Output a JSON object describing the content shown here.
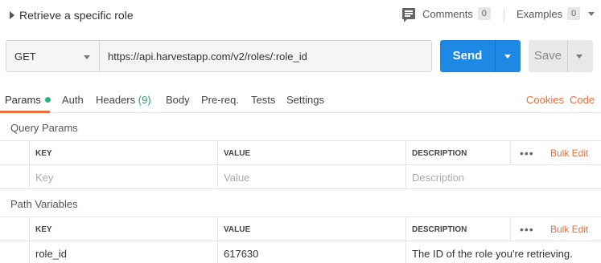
{
  "request": {
    "name": "Retrieve a specific role",
    "method": "GET",
    "url": "https://api.harvestapp.com/v2/roles/:role_id"
  },
  "header": {
    "comments_label": "Comments",
    "comments_count": "0",
    "examples_label": "Examples",
    "examples_count": "0"
  },
  "actions": {
    "send_label": "Send",
    "save_label": "Save"
  },
  "tabs": {
    "params": "Params",
    "auth": "Auth",
    "headers": "Headers",
    "headers_count": "(9)",
    "body": "Body",
    "prereq": "Pre-req.",
    "tests": "Tests",
    "settings": "Settings",
    "cookies": "Cookies",
    "code": "Code"
  },
  "query_params": {
    "title": "Query Params",
    "columns": [
      "KEY",
      "VALUE",
      "DESCRIPTION"
    ],
    "bulk_edit": "Bulk Edit",
    "more": "•••",
    "placeholder": {
      "key": "Key",
      "value": "Value",
      "description": "Description"
    }
  },
  "path_variables": {
    "title": "Path Variables",
    "columns": [
      "KEY",
      "VALUE",
      "DESCRIPTION"
    ],
    "bulk_edit": "Bulk Edit",
    "more": "•••",
    "rows": [
      {
        "key": "role_id",
        "value": "617630",
        "description": "The ID of the role you're retrieving."
      }
    ]
  },
  "colors": {
    "accent_orange": "#f26b3a",
    "send_blue": "#1e88e5",
    "active_dot": "#26b47f"
  }
}
